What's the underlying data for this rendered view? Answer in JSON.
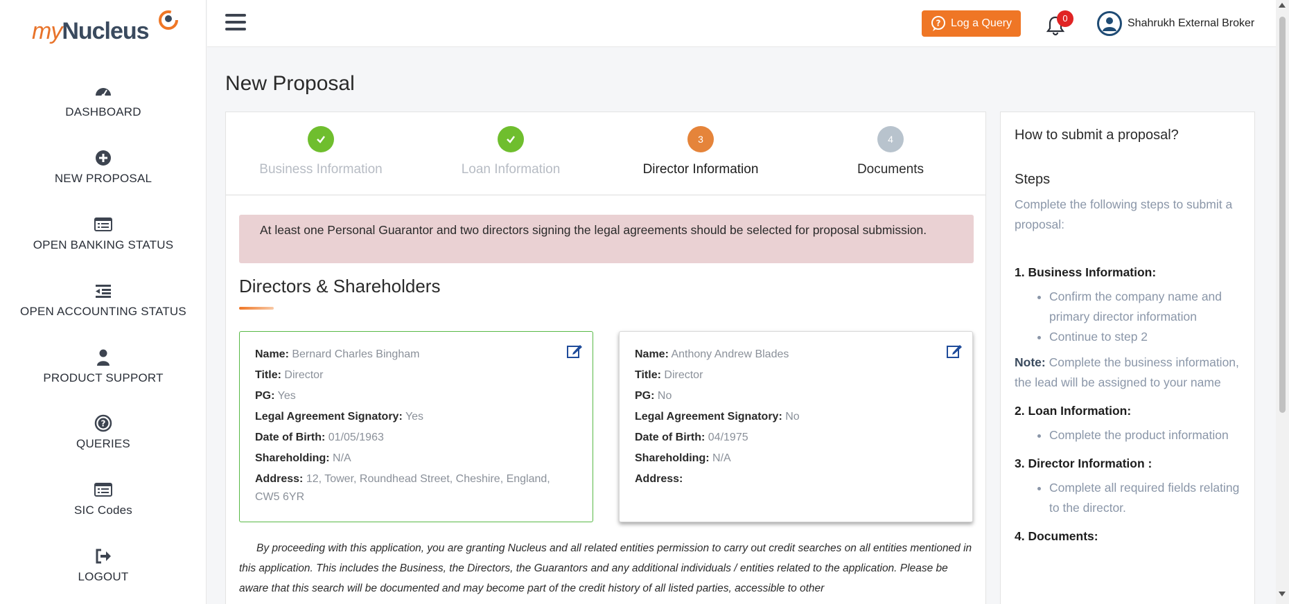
{
  "brand": {
    "part1": "my",
    "part2": "Nucleus",
    "accent": "#ef7625"
  },
  "sidebar": {
    "items": [
      {
        "label": "DASHBOARD",
        "icon": "dashboard-icon"
      },
      {
        "label": "NEW PROPOSAL",
        "icon": "plus-circle-icon"
      },
      {
        "label": "OPEN BANKING STATUS",
        "icon": "list-icon"
      },
      {
        "label": "OPEN ACCOUNTING STATUS",
        "icon": "outdent-icon"
      },
      {
        "label": "PRODUCT SUPPORT",
        "icon": "user-icon"
      },
      {
        "label": "QUERIES",
        "icon": "question-circle-icon"
      },
      {
        "label": "SIC Codes",
        "icon": "list-icon"
      },
      {
        "label": "LOGOUT",
        "icon": "logout-icon"
      }
    ]
  },
  "topbar": {
    "log_query_label": "Log a Query",
    "notifications_count": "0",
    "user_name": "Shahrukh External Broker"
  },
  "page_title": "New Proposal",
  "stepper": {
    "steps": [
      {
        "number": "1",
        "label": "Business Information",
        "state": "done"
      },
      {
        "number": "2",
        "label": "Loan Information",
        "state": "done"
      },
      {
        "number": "3",
        "label": "Director Information",
        "state": "active"
      },
      {
        "number": "4",
        "label": "Documents",
        "state": "todo"
      }
    ]
  },
  "alert_text": "At least one Personal Guarantor and two directors signing the legal agreements should be selected for proposal submission.",
  "section_title": "Directors & Shareholders",
  "field_labels": {
    "name": "Name:",
    "title": "Title:",
    "pg": "PG:",
    "signatory": "Legal Agreement Signatory:",
    "dob": "Date of Birth:",
    "shareholding": "Shareholding:",
    "address": "Address:"
  },
  "directors": [
    {
      "name": "Bernard Charles Bingham",
      "title": "Director",
      "pg": "Yes",
      "signatory": "Yes",
      "dob": "01/05/1963",
      "shareholding": "N/A",
      "address": "12, Tower, Roundhead Street, Cheshire, England, CW5 6YR"
    },
    {
      "name": "Anthony Andrew Blades",
      "title": "Director",
      "pg": "No",
      "signatory": "No",
      "dob": "04/1975",
      "shareholding": "N/A",
      "address": ""
    }
  ],
  "disclaimer": "By proceeding with this application, you are granting Nucleus and all related entities permission to carry out credit searches on all entities mentioned in this application. This includes the Business, the Directors, the Guarantors and any additional individuals / entities related to the application. Please be aware that this search will be documented and may become part of the credit history of all listed parties, accessible to other",
  "help": {
    "title": "How to submit a proposal?",
    "steps_heading": "Steps",
    "intro": "Complete the following steps to submit a proposal:",
    "s1_heading": "1. Business Information:",
    "s1_items": [
      "Confirm the company name and primary director information",
      "Continue to step 2"
    ],
    "note_label": "Note:",
    "note_text": " Complete the business information, the lead will be assigned to your name",
    "s2_heading": "2. Loan Information:",
    "s2_items": [
      "Complete the product information"
    ],
    "s3_heading": "3. Director Information :",
    "s3_items": [
      "Complete all required fields relating to the director."
    ],
    "s4_heading": "4. Documents:"
  }
}
